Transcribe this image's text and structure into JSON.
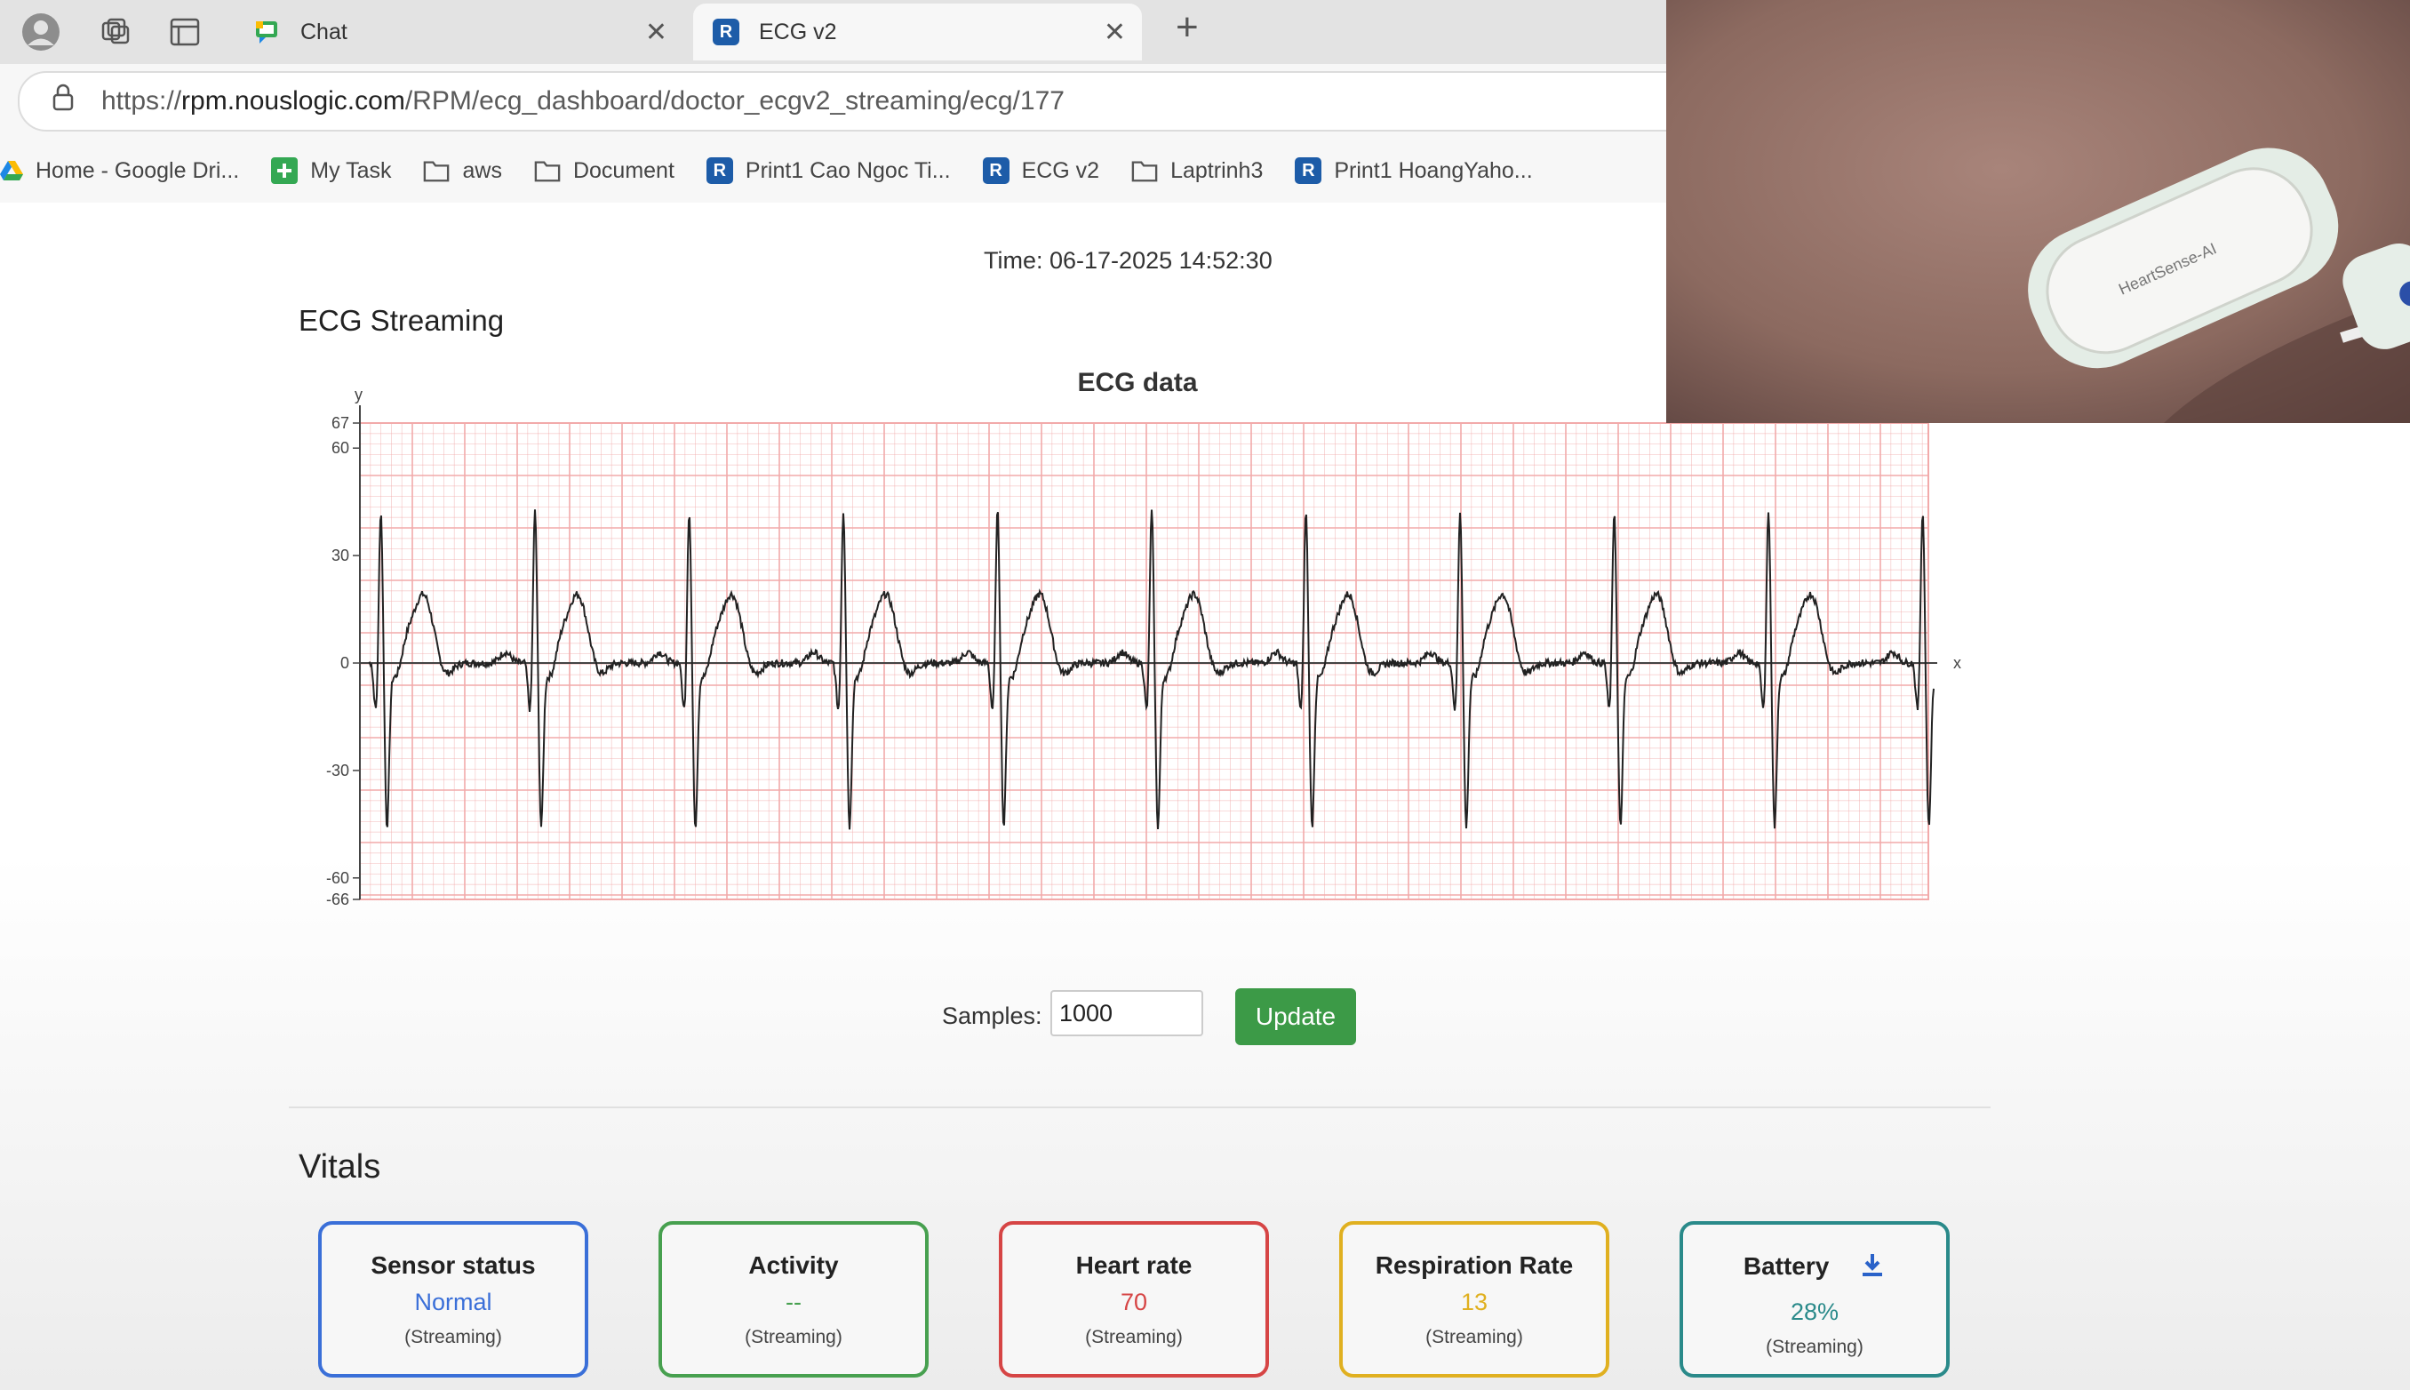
{
  "browser": {
    "tabs": [
      {
        "label": "Chat",
        "active": false
      },
      {
        "label": "ECG v2",
        "active": true
      }
    ],
    "url_prefix": "https://",
    "url_host": "rpm.nouslogic.com",
    "url_path": "/RPM/ecg_dashboard/doctor_ecgv2_streaming/ecg/177",
    "bookmarks": [
      "Home - Google Dri...",
      "My Task",
      "aws",
      "Document",
      "Print1 Cao Ngoc Ti...",
      "ECG v2",
      "Laptrinh3",
      "Print1 HoangYaho..."
    ]
  },
  "page": {
    "timestamp": "Time: 06-17-2025 14:52:30",
    "ecg_section_title": "ECG Streaming",
    "samples_label": "Samples:",
    "samples_value": "1000",
    "update_label": "Update",
    "vitals_title": "Vitals"
  },
  "vitals": [
    {
      "title": "Sensor status",
      "value": "Normal",
      "sub": "(Streaming)",
      "color": "#3a6fd8"
    },
    {
      "title": "Activity",
      "value": "--",
      "sub": "(Streaming)",
      "color": "#47a04f"
    },
    {
      "title": "Heart rate",
      "value": "70",
      "sub": "(Streaming)",
      "color": "#d64545"
    },
    {
      "title": "Respiration Rate",
      "value": "13",
      "sub": "(Streaming)",
      "color": "#e0b020"
    },
    {
      "title": "Battery",
      "value": "28%",
      "sub": "(Streaming)",
      "color": "#2a8a8a",
      "icon": "download-icon"
    }
  ],
  "chart_data": {
    "type": "line",
    "title": "ECG data",
    "xlabel": "x",
    "ylabel": "y",
    "ylim": [
      -66,
      67
    ],
    "yticks": [
      67,
      60,
      30,
      0,
      -30,
      -60,
      -66
    ],
    "grid": true,
    "grid_color": "#f2aaaa",
    "line_color": "#222222",
    "beats": 10,
    "r_peak": 45,
    "s_trough": -45,
    "t_wave": 19
  },
  "overlay": {
    "device_label": "HeartSense-AI"
  }
}
